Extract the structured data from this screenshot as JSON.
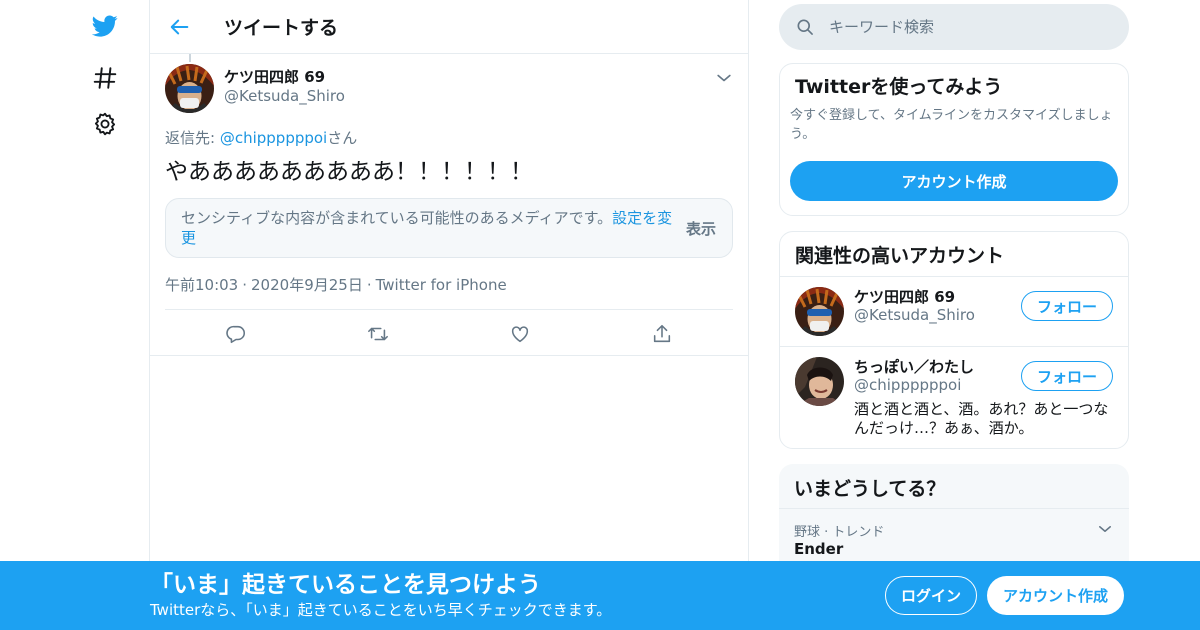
{
  "nav": {
    "items": [
      {
        "icon": "twitter-bird-icon"
      },
      {
        "icon": "hashtag-icon"
      },
      {
        "icon": "gear-icon"
      }
    ]
  },
  "header": {
    "title": "ツイートする"
  },
  "tweet": {
    "author_name": "ケツ田四郎 69",
    "author_handle": "@Ketsuda_Shiro",
    "reply_prefix": "返信先: ",
    "reply_mention": "@chippppppoi",
    "reply_suffix": "さん",
    "text": "やあああああああああ！！！！！！",
    "sensitive_notice": "センシティブな内容が含まれている可能性のあるメディアです。",
    "sensitive_link": "設定を変更",
    "show_label": "表示",
    "time": "午前10:03",
    "date": "2020年9月25日",
    "source": "Twitter for iPhone",
    "meta_separator": "·"
  },
  "search": {
    "placeholder": "キーワード検索"
  },
  "signup_card": {
    "title": "Twitterを使ってみよう",
    "subtitle": "今すぐ登録して、タイムラインをカスタマイズしましょう。",
    "button": "アカウント作成"
  },
  "who_to_follow": {
    "title": "関連性の高いアカウント",
    "accounts": [
      {
        "name": "ケツ田四郎 69",
        "handle": "@Ketsuda_Shiro",
        "follow": "フォロー",
        "bio": ""
      },
      {
        "name": "ちっぽい／わたし",
        "handle": "@chippppppoi",
        "follow": "フォロー",
        "bio": "酒と酒と酒と、酒。あれ？あと一つなんだっけ…？あぁ、酒か。"
      }
    ]
  },
  "trends": {
    "title": "いまどうしてる？",
    "items": [
      {
        "category": "野球 · トレンド",
        "name": "Ender"
      }
    ]
  },
  "banner": {
    "title": "「いま」起きていることを見つけよう",
    "subtitle": "Twitterなら、「いま」起きていることをいち早くチェックできます。",
    "login": "ログイン",
    "signup": "アカウント作成"
  },
  "colors": {
    "accent": "#1da1f2",
    "link": "#1b95e0",
    "muted": "#657786",
    "border": "#e6ecf0"
  }
}
